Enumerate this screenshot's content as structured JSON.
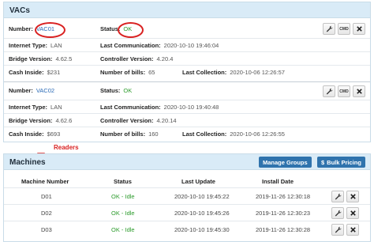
{
  "vacs": {
    "title": "VACs",
    "labels": {
      "number": "Number:",
      "status": "Status:",
      "internet_type": "Internet Type:",
      "last_communication": "Last Communication:",
      "bridge_version": "Bridge Version:",
      "controller_version": "Controller Version:",
      "cash_inside": "Cash Inside:",
      "number_of_bills": "Number of bills:",
      "last_collection": "Last Collection:"
    },
    "actions": {
      "cmd": "CMD"
    },
    "items": [
      {
        "number": "VAC01",
        "status": "OK",
        "internet_type": "LAN",
        "last_communication": "2020-10-10 19:46:04",
        "bridge_version": "4.62.5",
        "controller_version": "4.20.4",
        "cash_inside": "$231",
        "number_of_bills": "65",
        "last_collection": "2020-10-06 12:26:57"
      },
      {
        "number": "VAC02",
        "status": "OK",
        "internet_type": "LAN",
        "last_communication": "2020-10-10 19:40:48",
        "bridge_version": "4.62.6",
        "controller_version": "4.20.14",
        "cash_inside": "$693",
        "number_of_bills": "160",
        "last_collection": "2020-10-06 12:26:55"
      }
    ]
  },
  "machines": {
    "title": "Machines",
    "manage_groups": "Manage Groups",
    "bulk_pricing": "Bulk Pricing",
    "annotation": "Readers",
    "columns": [
      "Machine Number",
      "Status",
      "Last Update",
      "Install Date"
    ],
    "rows": [
      {
        "number": "D01",
        "status": "OK - Idle",
        "last_update": "2020-10-10 19:45:22",
        "install_date": "2019-11-26 12:30:18"
      },
      {
        "number": "D02",
        "status": "OK - Idle",
        "last_update": "2020-10-10 19:45:26",
        "install_date": "2019-11-26 12:30:23"
      },
      {
        "number": "D03",
        "status": "OK - Idle",
        "last_update": "2020-10-10 19:45:30",
        "install_date": "2019-11-26 12:30:28"
      }
    ]
  },
  "colors": {
    "header_bg": "#d9ebf7",
    "link": "#2a6ab6",
    "ok": "#2c9b2c",
    "primary_button": "#2f73ad",
    "annotation": "#d92222"
  }
}
